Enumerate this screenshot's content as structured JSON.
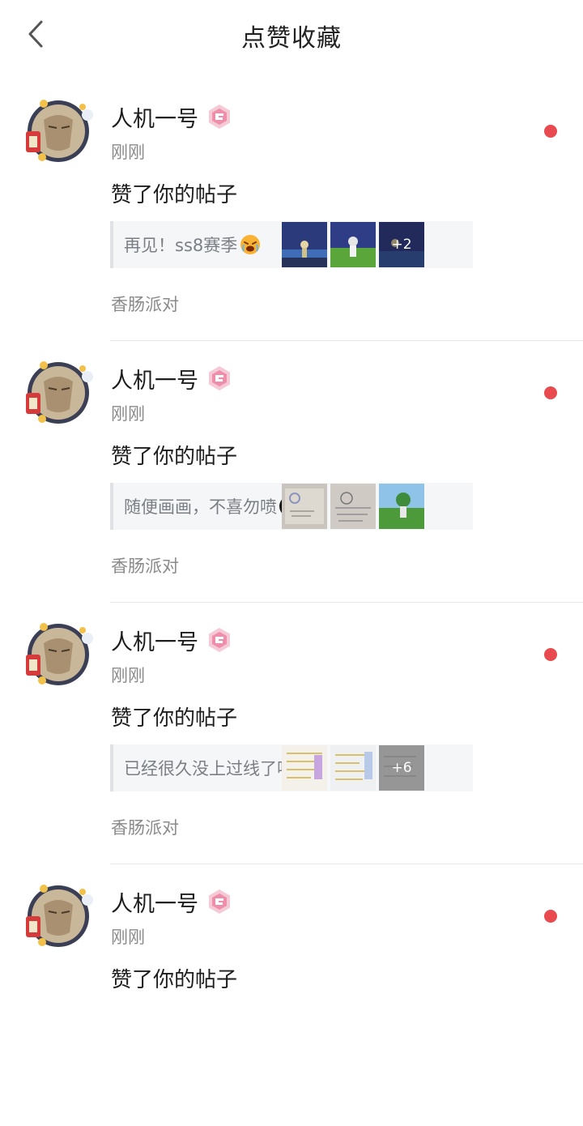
{
  "header": {
    "title": "点赞收藏",
    "back_icon": "chevron-left-icon"
  },
  "accent_color": "#e84a4f",
  "items": [
    {
      "user_name": "人机一号",
      "time": "刚刚",
      "action": "赞了你的帖子",
      "post_text": "再见！ss8赛季",
      "post_emoji": "crying-face-icon",
      "thumb_more": "+2",
      "source": "香肠派对"
    },
    {
      "user_name": "人机一号",
      "time": "刚刚",
      "action": "赞了你的帖子",
      "post_text": "随便画画，不喜勿喷",
      "post_emoji": "dark-face-icon",
      "thumb_more": "",
      "source": "香肠派对"
    },
    {
      "user_name": "人机一号",
      "time": "刚刚",
      "action": "赞了你的帖子",
      "post_text": "已经很久没上过线了吧",
      "post_emoji": "sad-face-icon",
      "thumb_more": "+6",
      "source": "香肠派对"
    },
    {
      "user_name": "人机一号",
      "time": "刚刚",
      "action": "赞了你的帖子"
    }
  ]
}
